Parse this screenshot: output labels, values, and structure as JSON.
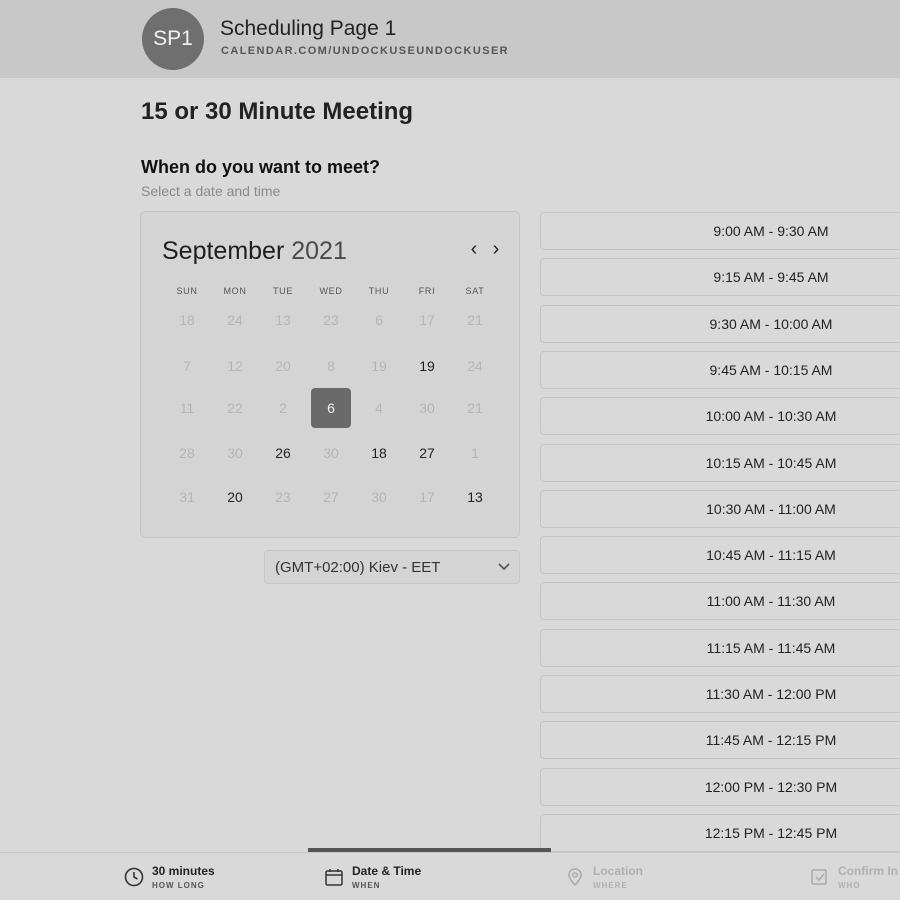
{
  "header": {
    "avatar_initials": "SP1",
    "page_name": "Scheduling Page 1",
    "url": "CALENDAR.COM/UNDOCKUSEUNDOCKUSER"
  },
  "meeting_title": "15 or 30 Minute Meeting",
  "section": {
    "title": "When do you want to meet?",
    "subtitle": "Select a date and time"
  },
  "calendar": {
    "month": "September",
    "year": "2021",
    "prev_glyph": "‹",
    "next_glyph": "›",
    "weekdays": [
      "SUN",
      "MON",
      "TUE",
      "WED",
      "THU",
      "FRI",
      "SAT"
    ],
    "weeks": [
      [
        {
          "d": "18",
          "s": "disabled"
        },
        {
          "d": "24",
          "s": "disabled"
        },
        {
          "d": "13",
          "s": "disabled"
        },
        {
          "d": "23",
          "s": "disabled"
        },
        {
          "d": "6",
          "s": "disabled"
        },
        {
          "d": "17",
          "s": "disabled"
        },
        {
          "d": "21",
          "s": "disabled"
        }
      ],
      [
        {
          "d": "7",
          "s": "disabled"
        },
        {
          "d": "12",
          "s": "disabled"
        },
        {
          "d": "20",
          "s": "disabled"
        },
        {
          "d": "8",
          "s": "disabled"
        },
        {
          "d": "19",
          "s": "disabled"
        },
        {
          "d": "19",
          "s": "available"
        },
        {
          "d": "24",
          "s": "disabled"
        }
      ],
      [
        {
          "d": "11",
          "s": "disabled"
        },
        {
          "d": "22",
          "s": "disabled"
        },
        {
          "d": "2",
          "s": "disabled"
        },
        {
          "d": "6",
          "s": "selected"
        },
        {
          "d": "4",
          "s": "disabled"
        },
        {
          "d": "30",
          "s": "disabled"
        },
        {
          "d": "21",
          "s": "disabled"
        }
      ],
      [
        {
          "d": "28",
          "s": "disabled"
        },
        {
          "d": "30",
          "s": "disabled"
        },
        {
          "d": "26",
          "s": "available"
        },
        {
          "d": "30",
          "s": "disabled"
        },
        {
          "d": "18",
          "s": "available"
        },
        {
          "d": "27",
          "s": "available"
        },
        {
          "d": "1",
          "s": "disabled"
        }
      ],
      [
        {
          "d": "31",
          "s": "disabled"
        },
        {
          "d": "20",
          "s": "available"
        },
        {
          "d": "23",
          "s": "disabled"
        },
        {
          "d": "27",
          "s": "disabled"
        },
        {
          "d": "30",
          "s": "disabled"
        },
        {
          "d": "17",
          "s": "disabled"
        },
        {
          "d": "13",
          "s": "available"
        }
      ]
    ]
  },
  "timezone": {
    "label": "(GMT+02:00) Kiev - EET"
  },
  "time_slots": [
    "9:00 AM - 9:30 AM",
    "9:15 AM - 9:45 AM",
    "9:30 AM - 10:00 AM",
    "9:45 AM - 10:15 AM",
    "10:00 AM - 10:30 AM",
    "10:15 AM - 10:45 AM",
    "10:30 AM - 11:00 AM",
    "10:45 AM - 11:15 AM",
    "11:00 AM - 11:30 AM",
    "11:15 AM - 11:45 AM",
    "11:30 AM - 12:00 PM",
    "11:45 AM - 12:15 PM",
    "12:00 PM - 12:30 PM",
    "12:15 PM - 12:45 PM"
  ],
  "steps": [
    {
      "label": "30 minutes",
      "sub": "HOW LONG",
      "icon": "clock-icon",
      "state": "done"
    },
    {
      "label": "Date & Time",
      "sub": "WHEN",
      "icon": "calendar-icon",
      "state": "active"
    },
    {
      "label": "Location",
      "sub": "WHERE",
      "icon": "location-pin-icon",
      "state": "inactive"
    },
    {
      "label": "Confirm In",
      "sub": "WHO",
      "icon": "confirm-icon",
      "state": "inactive"
    }
  ]
}
